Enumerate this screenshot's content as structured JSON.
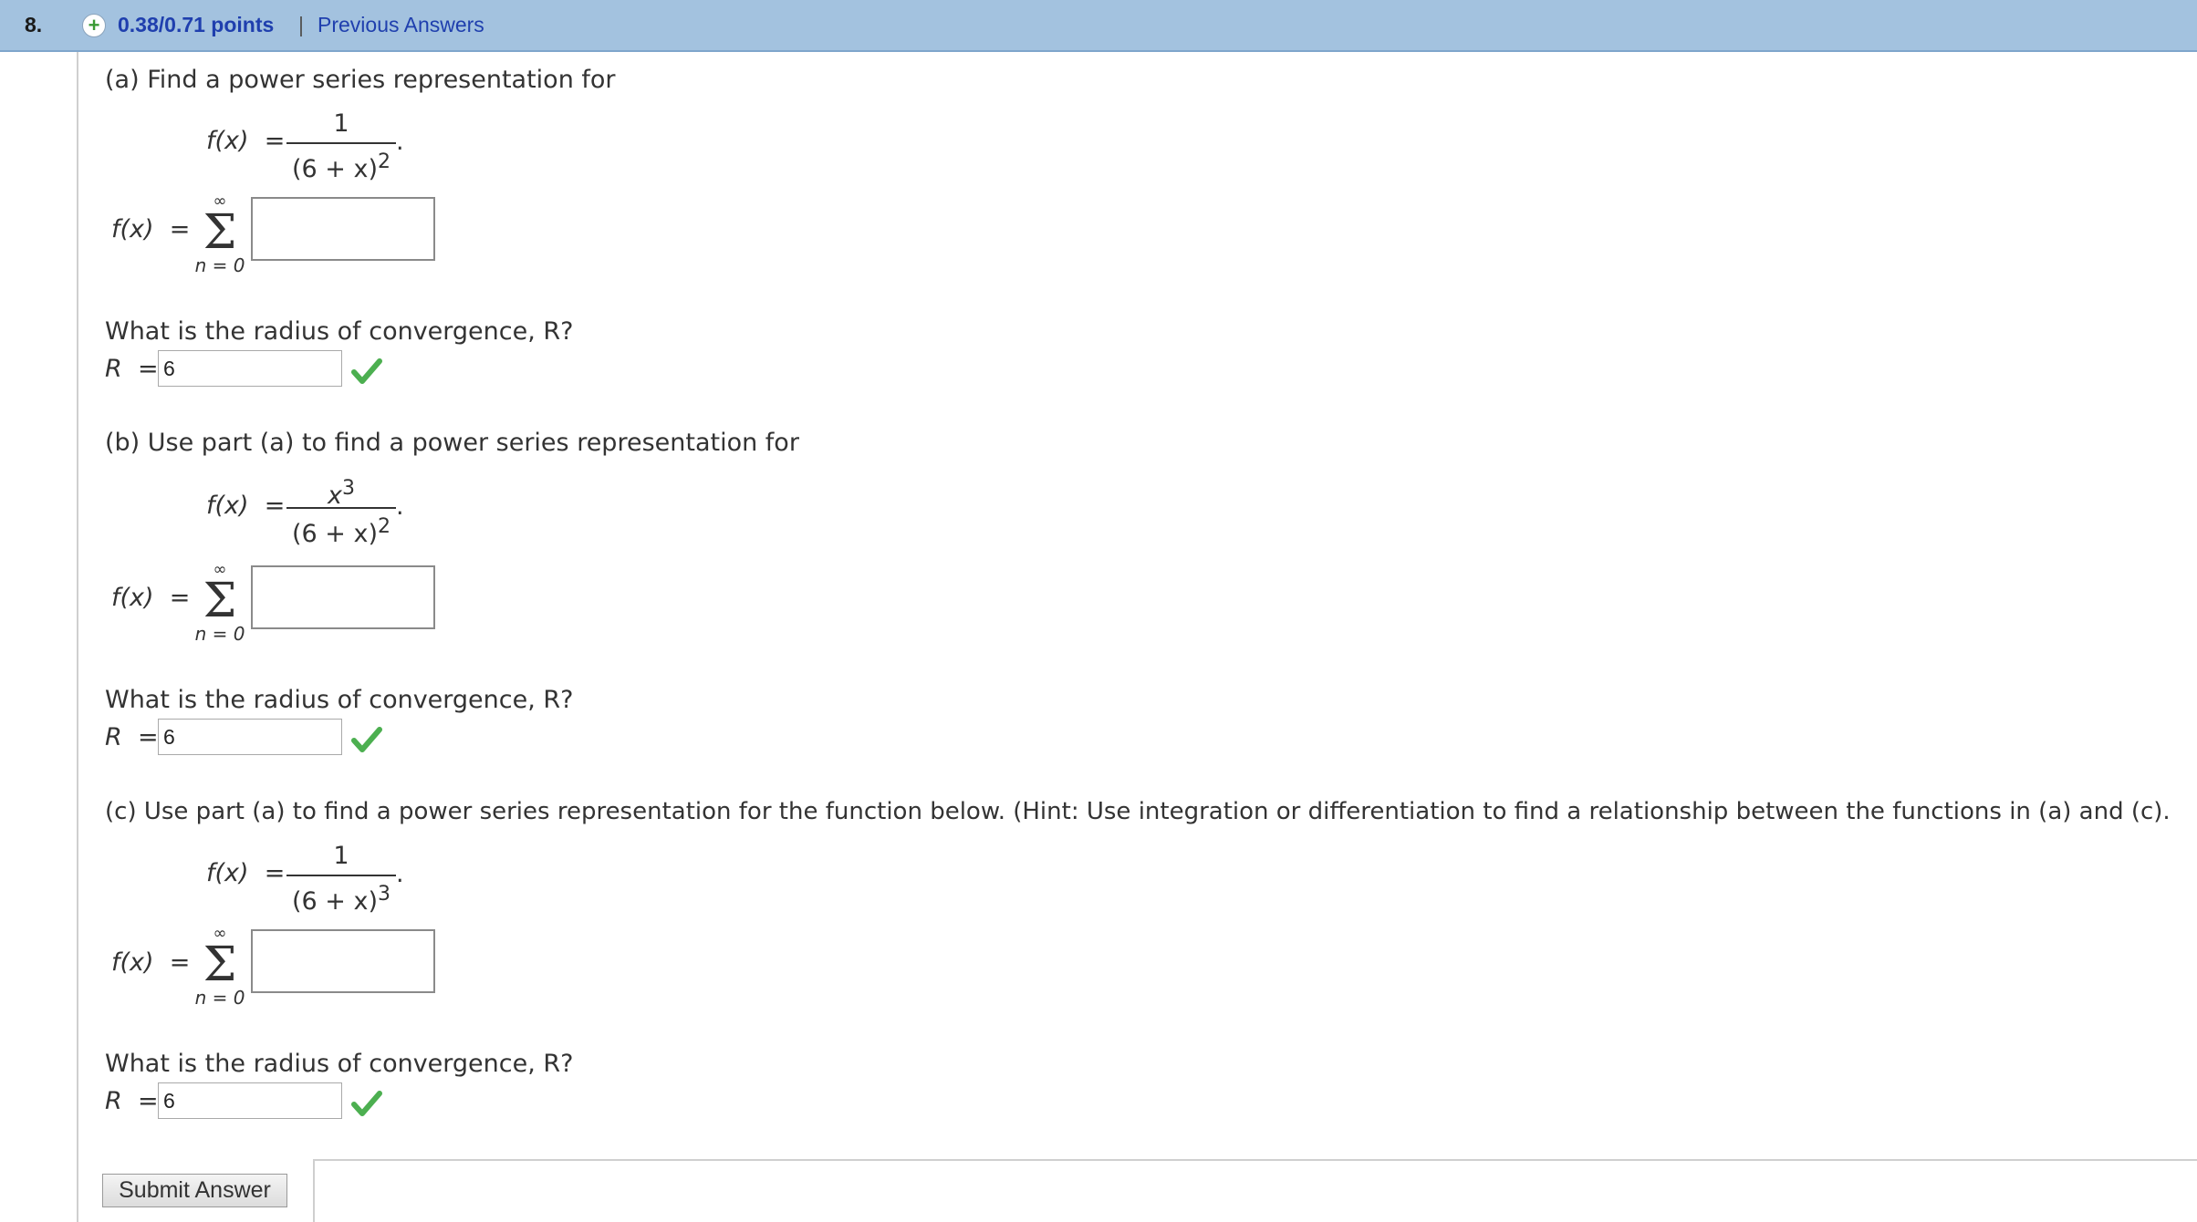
{
  "header": {
    "question_number": "8.",
    "points": "0.38/0.71 points",
    "separator": "|",
    "previous_answers": "Previous Answers"
  },
  "fx": "f(x)",
  "equals": "=",
  "period": ".",
  "sum_upper": "∞",
  "sum_symbol": "Σ",
  "sum_lower": "n = 0",
  "radius_label": "R",
  "part_a": {
    "prompt": "(a) Find a power series representation for",
    "numerator": "1",
    "denominator_base": "(6 + x)",
    "denominator_exp": "2",
    "radius_question": "What is the radius of convergence, R?",
    "radius_value": "6"
  },
  "part_b": {
    "prompt": "(b) Use part (a) to find a power series representation for",
    "numerator_base": "x",
    "numerator_exp": "3",
    "denominator_base": "(6 + x)",
    "denominator_exp": "2",
    "radius_question": "What is the radius of convergence, R?",
    "radius_value": "6"
  },
  "part_c": {
    "prompt": "(c) Use part (a) to find a power series representation for the function below. (Hint: Use integration or differentiation to find a relationship between the functions in (a) and (c).",
    "numerator": "1",
    "denominator_base": "(6 + x)",
    "denominator_exp": "3",
    "radius_question": "What is the radius of convergence, R?",
    "radius_value": "6"
  },
  "submit_label": "Submit Answer",
  "colors": {
    "header_bg": "#a3c2df",
    "link": "#1f3fae",
    "check": "#4caf50"
  }
}
